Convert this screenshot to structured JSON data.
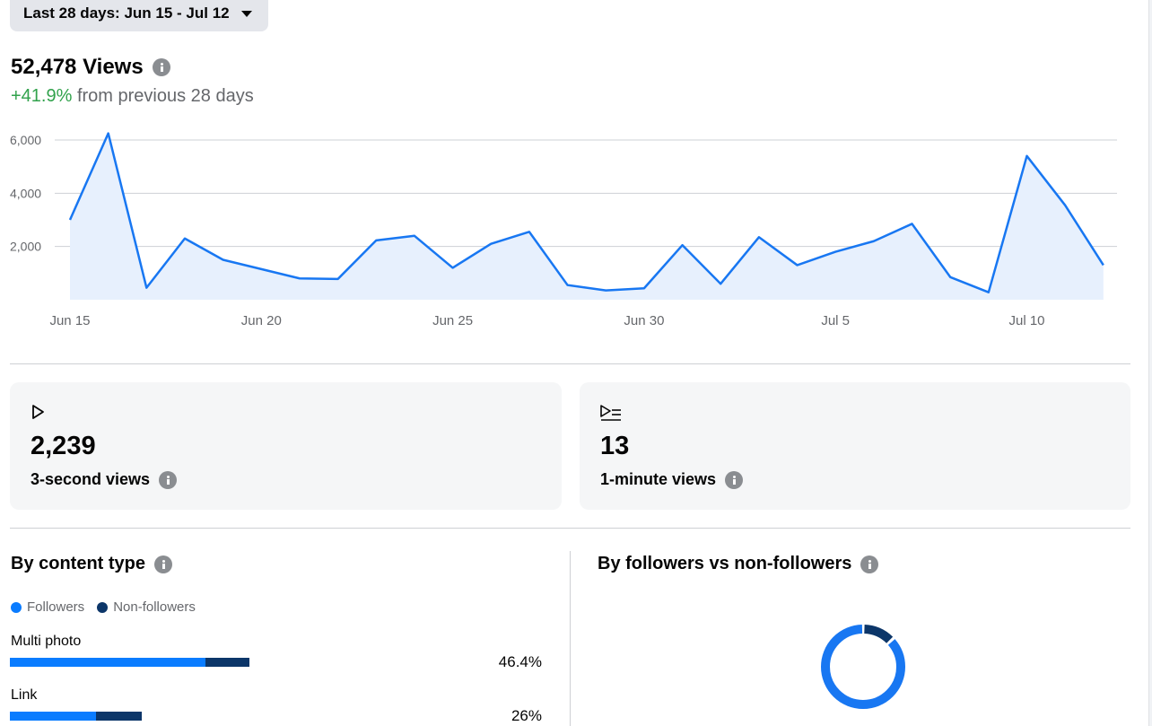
{
  "date_range": {
    "label": "Last 28 days: Jun 15 - Jul 12"
  },
  "views": {
    "total": "52,478 Views",
    "change": "+41.9%",
    "change_suffix": " from previous 28 days"
  },
  "chart_data": {
    "type": "area",
    "x": [
      "Jun 15",
      "Jun 16",
      "Jun 17",
      "Jun 18",
      "Jun 19",
      "Jun 20",
      "Jun 21",
      "Jun 22",
      "Jun 23",
      "Jun 24",
      "Jun 25",
      "Jun 26",
      "Jun 27",
      "Jun 28",
      "Jun 29",
      "Jun 30",
      "Jul 1",
      "Jul 2",
      "Jul 3",
      "Jul 4",
      "Jul 5",
      "Jul 6",
      "Jul 7",
      "Jul 8",
      "Jul 9",
      "Jul 10",
      "Jul 11",
      "Jul 12"
    ],
    "values": [
      3000,
      6250,
      450,
      2300,
      1500,
      1150,
      800,
      780,
      2230,
      2400,
      1200,
      2100,
      2550,
      550,
      350,
      430,
      2050,
      600,
      2350,
      1300,
      1800,
      2200,
      2850,
      850,
      280,
      5400,
      3550,
      1300
    ],
    "x_tick_labels": [
      "Jun 15",
      "Jun 20",
      "Jun 25",
      "Jun 30",
      "Jul 5",
      "Jul 10"
    ],
    "y_tick_labels": [
      "2,000",
      "4,000",
      "6,000"
    ],
    "y_ticks": [
      2000,
      4000,
      6000
    ],
    "ylim": [
      0,
      6000
    ],
    "grid": true,
    "line_color": "#1877f2",
    "fill_color": "#e7f0fd"
  },
  "cards": [
    {
      "value": "2,239",
      "label": "3-second views",
      "icon": "play-icon"
    },
    {
      "value": "13",
      "label": "1-minute views",
      "icon": "play-list-icon"
    }
  ],
  "content_type": {
    "title": "By content type",
    "legend": [
      {
        "label": "Followers",
        "color": "#0a7cff"
      },
      {
        "label": "Non-followers",
        "color": "#0c3669"
      }
    ],
    "rows": [
      {
        "label": "Multi photo",
        "pct": "46.4%",
        "followers_share": 0.418,
        "non_followers_share": 0.094
      },
      {
        "label": "Link",
        "pct": "26%",
        "followers_share": 0.184,
        "non_followers_share": 0.099
      }
    ]
  },
  "followers_split": {
    "title": "By followers vs non-followers",
    "followers_share": 0.87,
    "non_followers_share": 0.13,
    "colors": {
      "followers": "#1877f2",
      "non_followers": "#0c3669"
    }
  }
}
